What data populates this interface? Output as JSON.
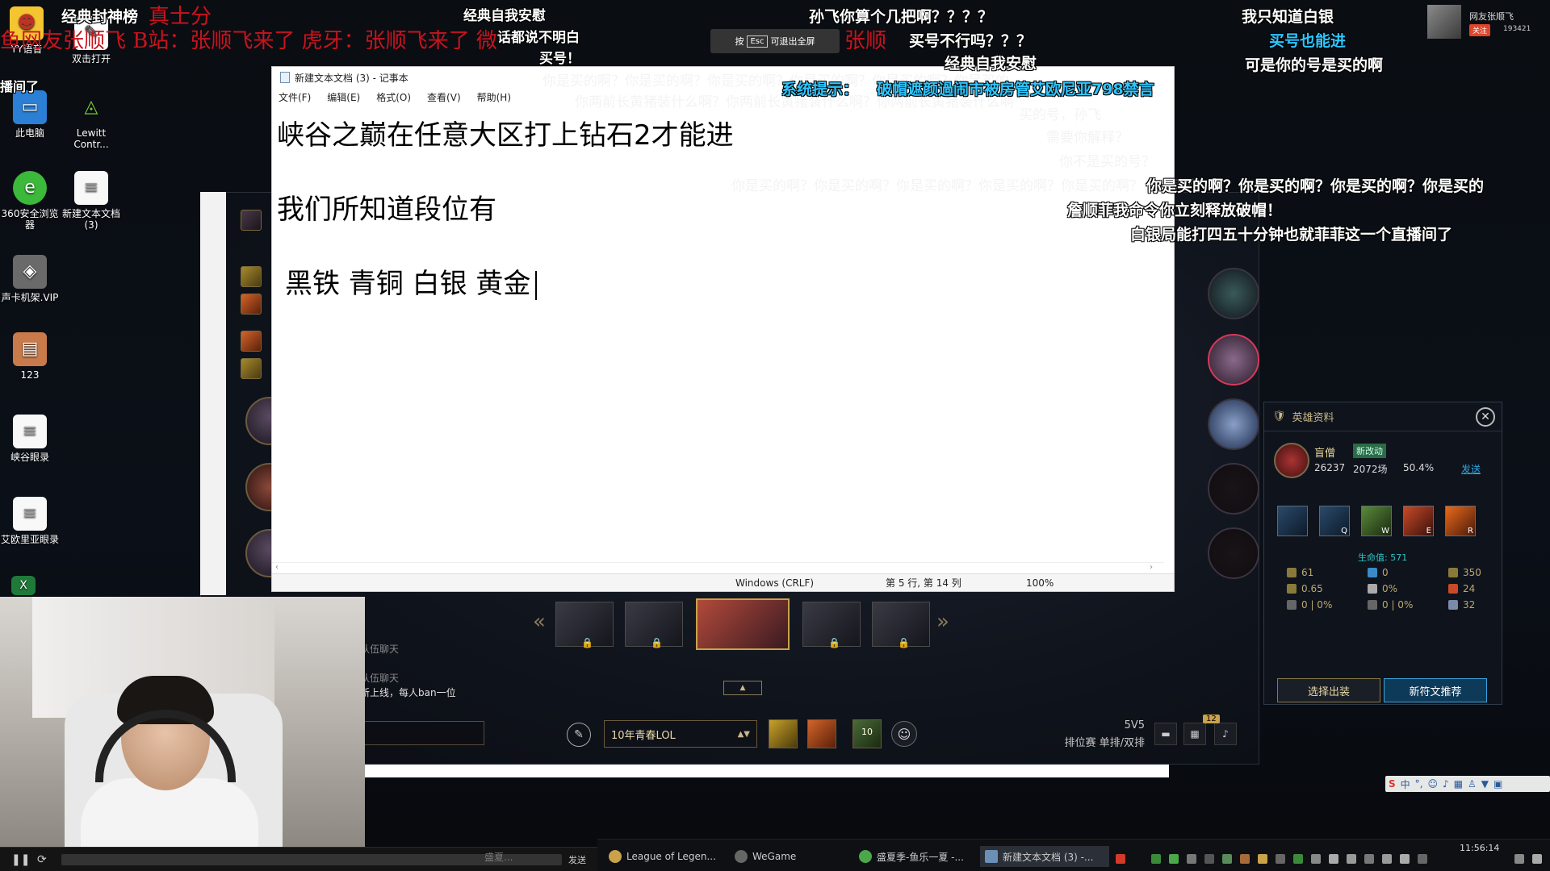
{
  "desktop": {
    "icons": [
      {
        "label": "YY语音",
        "name": "yy-voice-icon"
      },
      {
        "label": "双击打开",
        "name": "double-click-open-icon"
      },
      {
        "label": "此电脑",
        "name": "this-pc-icon"
      },
      {
        "label": "Lewitt Contr...",
        "name": "lewitt-control-icon"
      },
      {
        "label": "360安全浏览器",
        "name": "browser-360-icon"
      },
      {
        "label": "新建文本文档 (3)",
        "name": "text-doc-icon"
      },
      {
        "label": "声卡机架.VIP",
        "name": "soundcard-rack-icon"
      },
      {
        "label": "123",
        "name": "folder-123-icon"
      },
      {
        "label": "峡谷眼录",
        "name": "canyon-notes-icon"
      },
      {
        "label": "艾欧里亚眼录",
        "name": "ionia-notes-icon"
      }
    ],
    "left_cut_text": "播间了"
  },
  "notepad": {
    "title": "新建文本文档 (3) - 记事本",
    "menu": [
      "文件(F)",
      "编辑(E)",
      "格式(O)",
      "查看(V)",
      "帮助(H)"
    ],
    "lines": [
      "峡谷之巅在任意大区打上钻石2才能进",
      "",
      "我们所知道段位有",
      "",
      "黑铁 青铜 白银 黄金"
    ],
    "status": {
      "encoding": "Windows (CRLF)",
      "position": "第 5 行, 第 14 列",
      "zoom": "100%"
    }
  },
  "esc_hint": {
    "pre": "按",
    "key": "Esc",
    "post": "可退出全屏"
  },
  "streamer": {
    "name": "网友张顺飞",
    "follow": "关注",
    "count": "193421"
  },
  "danmaku": {
    "d1": "经典封神榜",
    "d2": "经典自我安慰",
    "d3": "孙飞你算个几把啊？？？？",
    "d4": "我只知道白银",
    "d5": "话都说不明白",
    "d6": "买号不行吗？？？",
    "d7": "买号也能进",
    "d8": "买号！",
    "d9": "经典自我安慰",
    "d10": "可是你的号是买的啊",
    "d11": "需要你解释？",
    "d12": "你不是买的号？",
    "d13": "你是买的啊？你是买的啊？你是买的啊？你是买的",
    "d14": "詹顺菲我命令你立刻释放破帽！",
    "d15": "白银局能打四五十分钟也就菲菲这一个直播间了",
    "d16": "买的号，孙飞",
    "red1": "鱼网友张顺飞 B站：张顺飞来了 虎牙：张顺飞来了 微",
    "red2": "真士分",
    "red3": "张顺",
    "faded1": "你是买的啊？你是买的啊？你是买的啊？你是买的啊？你是买的啊？你是买的",
    "faded2": "你两前长黄猪装什么啊？你两前长黄猪装什么啊？你两前长黄猪装什么啊",
    "faded3": "你是买的啊？你是买的啊？你是买的啊？你是买的啊？你是买的啊？你是买的",
    "sys_label": "系统提示：",
    "sys_text": "破帽遮颜過闹市被房管艾欧尼亚798禁言"
  },
  "champ_panel": {
    "title": "英雄资料",
    "close": "✕",
    "name": "盲僧",
    "new_tag": "新改动",
    "games_total": "26237",
    "games_played": "2072场",
    "win_rate": "50.4%",
    "send": "发送",
    "skills": [
      "",
      "Q",
      "W",
      "E",
      "R"
    ],
    "hp": "生命值: 571",
    "stats": [
      [
        "61",
        "0",
        "350"
      ],
      [
        "0.65",
        "0%",
        "24"
      ],
      [
        "0 | 0%",
        "0 | 0%",
        "32"
      ]
    ],
    "btn_build": "选择出装",
    "btn_runes": "新符文推荐"
  },
  "champ_select": {
    "loadout": "10年青春LOL",
    "mode_line1": "5V5",
    "mode_line2": "排位赛 单排/双排",
    "badge": "12",
    "chat1": "队伍聊天",
    "chat2": "队伍聊天",
    "chat3": "新上线，每人ban一位",
    "level": "10"
  },
  "player_bar": {
    "send": "发送"
  },
  "taskbar": {
    "items": [
      "League of Legen...",
      "WeGame",
      "盛夏季-鱼乐一夏 -...",
      "新建文本文档 (3) -..."
    ],
    "time": "11:56:14",
    "date": ""
  },
  "ime": {
    "lang": "中"
  }
}
